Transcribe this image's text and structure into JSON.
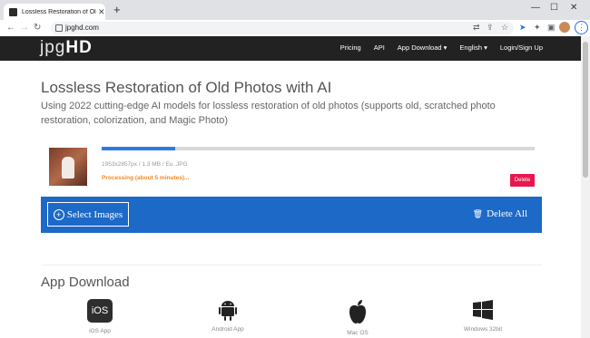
{
  "browser": {
    "tab_title": "Lossless Restoration of Old Photo",
    "url": "jpghd.com"
  },
  "site": {
    "logo_light": "jpg",
    "logo_bold": "HD",
    "nav": [
      "Pricing",
      "API",
      "App Download ▾",
      "English ▾",
      "Login/Sign Up"
    ]
  },
  "main": {
    "title": "Lossless Restoration of Old Photos with AI",
    "subtitle": "Using 2022 cutting-edge AI models for lossless restoration of old photos (supports old, scratched photo restoration, colorization, and Magic Photo)"
  },
  "upload": {
    "progress_fraction": 0.17,
    "meta": "1953x2857px / 1.3 MB / Eu..JPG",
    "status": "Processing (about 5 minutes)...",
    "delete_label": "Delete",
    "select_label": "Select Images",
    "delete_all_label": "Delete All"
  },
  "apps": {
    "heading": "App Download",
    "items": [
      {
        "label": "iOS App",
        "icon": "ios-icon"
      },
      {
        "label": "Android App",
        "icon": "android-icon"
      },
      {
        "label": "Mac OS",
        "icon": "apple-icon"
      },
      {
        "label": "Windows 32bit",
        "icon": "windows-icon"
      }
    ]
  },
  "colors": {
    "accent": "#1d69c7",
    "delete": "#e8174e",
    "status": "#f08a24",
    "nav_bg": "#222222"
  }
}
